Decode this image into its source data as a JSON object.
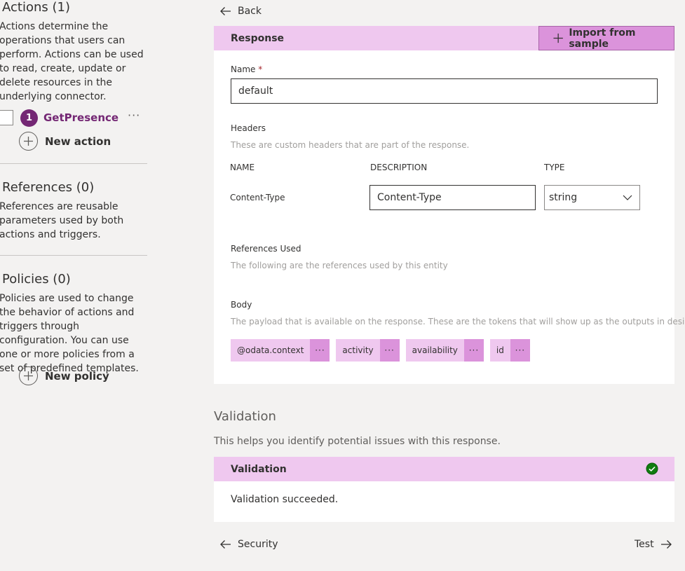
{
  "sidebar": {
    "actions": {
      "title": "Actions (1)",
      "description": "Actions determine the operations that users can perform. Actions can be used to read, create, update or delete resources in the underlying connector.",
      "items": [
        {
          "number": "1",
          "name": "GetPresence",
          "more": "···"
        }
      ],
      "new_label": "New action"
    },
    "references": {
      "title": "References (0)",
      "description": "References are reusable parameters used by both actions and triggers."
    },
    "policies": {
      "title": "Policies (0)",
      "description": "Policies are used to change the behavior of actions and triggers through configuration. You can use one or more policies from a set of predefined templates.",
      "new_label": "New policy"
    }
  },
  "nav": {
    "back_label": "Back",
    "prev_label": "Security",
    "next_label": "Test"
  },
  "response": {
    "header_title": "Response",
    "import_label": "Import from sample",
    "name_label": "Name",
    "required_mark": "*",
    "name_value": "default",
    "headers_label": "Headers",
    "headers_hint": "These are custom headers that are part of the response.",
    "columns": {
      "name": "NAME",
      "description": "DESCRIPTION",
      "type": "TYPE"
    },
    "header_rows": [
      {
        "name": "Content-Type",
        "description": "Content-Type",
        "type": "string"
      }
    ],
    "references_label": "References Used",
    "references_hint": "The following are the references used by this entity",
    "body_label": "Body",
    "body_hint": "The payload that is available on the response. These are the tokens that will show up as the outputs in designer.",
    "body_tokens": [
      {
        "label": "@odata.context",
        "more": "···"
      },
      {
        "label": "activity",
        "more": "···"
      },
      {
        "label": "availability",
        "more": "···"
      },
      {
        "label": "id",
        "more": "···"
      }
    ]
  },
  "validation": {
    "section_title": "Validation",
    "section_desc": "This helps you identify potential issues with this response.",
    "card_title": "Validation",
    "message": "Validation succeeded.",
    "status_color": "#107c10"
  },
  "colors": {
    "accent": "#742774",
    "header_bg": "#efc8ef",
    "button_bg": "#db93db"
  }
}
